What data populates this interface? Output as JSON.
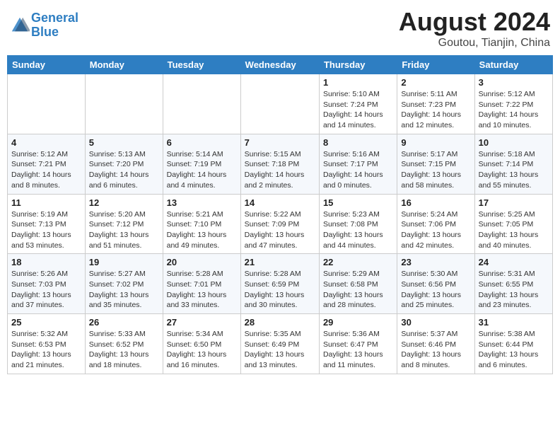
{
  "header": {
    "logo_line1": "General",
    "logo_line2": "Blue",
    "month": "August 2024",
    "location": "Goutou, Tianjin, China"
  },
  "weekdays": [
    "Sunday",
    "Monday",
    "Tuesday",
    "Wednesday",
    "Thursday",
    "Friday",
    "Saturday"
  ],
  "weeks": [
    [
      {
        "day": "",
        "info": ""
      },
      {
        "day": "",
        "info": ""
      },
      {
        "day": "",
        "info": ""
      },
      {
        "day": "",
        "info": ""
      },
      {
        "day": "1",
        "info": "Sunrise: 5:10 AM\nSunset: 7:24 PM\nDaylight: 14 hours\nand 14 minutes."
      },
      {
        "day": "2",
        "info": "Sunrise: 5:11 AM\nSunset: 7:23 PM\nDaylight: 14 hours\nand 12 minutes."
      },
      {
        "day": "3",
        "info": "Sunrise: 5:12 AM\nSunset: 7:22 PM\nDaylight: 14 hours\nand 10 minutes."
      }
    ],
    [
      {
        "day": "4",
        "info": "Sunrise: 5:12 AM\nSunset: 7:21 PM\nDaylight: 14 hours\nand 8 minutes."
      },
      {
        "day": "5",
        "info": "Sunrise: 5:13 AM\nSunset: 7:20 PM\nDaylight: 14 hours\nand 6 minutes."
      },
      {
        "day": "6",
        "info": "Sunrise: 5:14 AM\nSunset: 7:19 PM\nDaylight: 14 hours\nand 4 minutes."
      },
      {
        "day": "7",
        "info": "Sunrise: 5:15 AM\nSunset: 7:18 PM\nDaylight: 14 hours\nand 2 minutes."
      },
      {
        "day": "8",
        "info": "Sunrise: 5:16 AM\nSunset: 7:17 PM\nDaylight: 14 hours\nand 0 minutes."
      },
      {
        "day": "9",
        "info": "Sunrise: 5:17 AM\nSunset: 7:15 PM\nDaylight: 13 hours\nand 58 minutes."
      },
      {
        "day": "10",
        "info": "Sunrise: 5:18 AM\nSunset: 7:14 PM\nDaylight: 13 hours\nand 55 minutes."
      }
    ],
    [
      {
        "day": "11",
        "info": "Sunrise: 5:19 AM\nSunset: 7:13 PM\nDaylight: 13 hours\nand 53 minutes."
      },
      {
        "day": "12",
        "info": "Sunrise: 5:20 AM\nSunset: 7:12 PM\nDaylight: 13 hours\nand 51 minutes."
      },
      {
        "day": "13",
        "info": "Sunrise: 5:21 AM\nSunset: 7:10 PM\nDaylight: 13 hours\nand 49 minutes."
      },
      {
        "day": "14",
        "info": "Sunrise: 5:22 AM\nSunset: 7:09 PM\nDaylight: 13 hours\nand 47 minutes."
      },
      {
        "day": "15",
        "info": "Sunrise: 5:23 AM\nSunset: 7:08 PM\nDaylight: 13 hours\nand 44 minutes."
      },
      {
        "day": "16",
        "info": "Sunrise: 5:24 AM\nSunset: 7:06 PM\nDaylight: 13 hours\nand 42 minutes."
      },
      {
        "day": "17",
        "info": "Sunrise: 5:25 AM\nSunset: 7:05 PM\nDaylight: 13 hours\nand 40 minutes."
      }
    ],
    [
      {
        "day": "18",
        "info": "Sunrise: 5:26 AM\nSunset: 7:03 PM\nDaylight: 13 hours\nand 37 minutes."
      },
      {
        "day": "19",
        "info": "Sunrise: 5:27 AM\nSunset: 7:02 PM\nDaylight: 13 hours\nand 35 minutes."
      },
      {
        "day": "20",
        "info": "Sunrise: 5:28 AM\nSunset: 7:01 PM\nDaylight: 13 hours\nand 33 minutes."
      },
      {
        "day": "21",
        "info": "Sunrise: 5:28 AM\nSunset: 6:59 PM\nDaylight: 13 hours\nand 30 minutes."
      },
      {
        "day": "22",
        "info": "Sunrise: 5:29 AM\nSunset: 6:58 PM\nDaylight: 13 hours\nand 28 minutes."
      },
      {
        "day": "23",
        "info": "Sunrise: 5:30 AM\nSunset: 6:56 PM\nDaylight: 13 hours\nand 25 minutes."
      },
      {
        "day": "24",
        "info": "Sunrise: 5:31 AM\nSunset: 6:55 PM\nDaylight: 13 hours\nand 23 minutes."
      }
    ],
    [
      {
        "day": "25",
        "info": "Sunrise: 5:32 AM\nSunset: 6:53 PM\nDaylight: 13 hours\nand 21 minutes."
      },
      {
        "day": "26",
        "info": "Sunrise: 5:33 AM\nSunset: 6:52 PM\nDaylight: 13 hours\nand 18 minutes."
      },
      {
        "day": "27",
        "info": "Sunrise: 5:34 AM\nSunset: 6:50 PM\nDaylight: 13 hours\nand 16 minutes."
      },
      {
        "day": "28",
        "info": "Sunrise: 5:35 AM\nSunset: 6:49 PM\nDaylight: 13 hours\nand 13 minutes."
      },
      {
        "day": "29",
        "info": "Sunrise: 5:36 AM\nSunset: 6:47 PM\nDaylight: 13 hours\nand 11 minutes."
      },
      {
        "day": "30",
        "info": "Sunrise: 5:37 AM\nSunset: 6:46 PM\nDaylight: 13 hours\nand 8 minutes."
      },
      {
        "day": "31",
        "info": "Sunrise: 5:38 AM\nSunset: 6:44 PM\nDaylight: 13 hours\nand 6 minutes."
      }
    ]
  ]
}
